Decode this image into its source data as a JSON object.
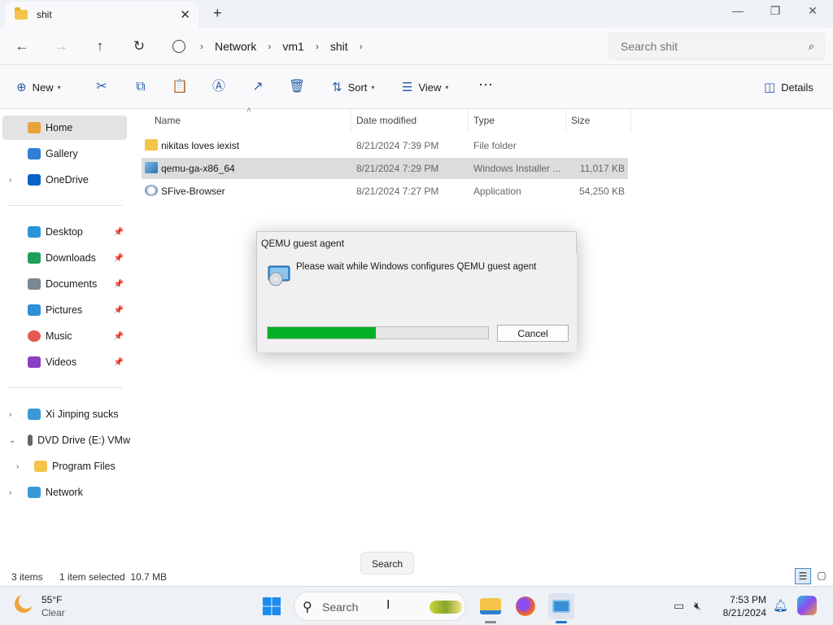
{
  "window": {
    "tab_title": "shit",
    "tab_close": "✕",
    "tab_add": "+",
    "minimize": "—",
    "maximize": "❐",
    "close": "✕"
  },
  "address": {
    "back": "←",
    "forward": "→",
    "up": "↑",
    "refresh": "↻",
    "breadcrumbs": [
      "Network",
      "vm1",
      "shit"
    ],
    "separator": "›",
    "search_placeholder": "Search shit",
    "search_icon": "⌕"
  },
  "toolbar": {
    "new_label": "New",
    "sort_label": "Sort",
    "view_label": "View",
    "more_label": "···",
    "details_label": "Details",
    "icons": {
      "new": "⊕",
      "cut": "✂",
      "copy": "⧉",
      "paste": "📋",
      "rename": "Ⓐ",
      "share": "↗",
      "delete": "🗑",
      "sort": "⇅",
      "view": "☰",
      "details": "◫"
    }
  },
  "sidebar": {
    "items": [
      {
        "label": "Home",
        "color": "#e8a23a"
      },
      {
        "label": "Gallery",
        "color": "#2f7fd6"
      },
      {
        "label": "OneDrive",
        "color": "#0a64c8"
      },
      {
        "label": "Desktop",
        "color": "#2b94d8"
      },
      {
        "label": "Downloads",
        "color": "#1f9e5a"
      },
      {
        "label": "Documents",
        "color": "#7a8794"
      },
      {
        "label": "Pictures",
        "color": "#2f8fd8"
      },
      {
        "label": "Music",
        "color": "#e5584f"
      },
      {
        "label": "Videos",
        "color": "#8b3fc4"
      },
      {
        "label": "Xi Jinping sucks",
        "color": "#3a9ad9"
      },
      {
        "label": "DVD Drive (E:) VMw",
        "color": "#666666"
      },
      {
        "label": "Program Files",
        "color": "#f5c44a"
      },
      {
        "label": "Network",
        "color": "#3a9ad9"
      }
    ],
    "pin": "📌",
    "chev_right": "›",
    "chev_down": "⌄"
  },
  "columns": {
    "name": "Name",
    "date": "Date modified",
    "type": "Type",
    "size": "Size",
    "sort_arrow": "˄"
  },
  "files": [
    {
      "name": "nikitas loves iexist",
      "date": "8/21/2024 7:39 PM",
      "type": "File folder",
      "size": ""
    },
    {
      "name": "qemu-ga-x86_64",
      "date": "8/21/2024 7:29 PM",
      "type": "Windows Installer ...",
      "size": "11,017 KB"
    },
    {
      "name": "SFive-Browser",
      "date": "8/21/2024 7:27 PM",
      "type": "Application",
      "size": "54,250 KB"
    }
  ],
  "dialog": {
    "title": "QEMU guest agent",
    "message": "Please wait while Windows configures QEMU guest agent",
    "progress": 0.49,
    "cancel_label": "Cancel"
  },
  "status": {
    "items_count": "3 items",
    "selection": "1 item selected  10.7 MB",
    "tooltip": "Search"
  },
  "taskbar": {
    "weather_temp": "55°F",
    "weather_desc": "Clear",
    "search_label": "Search",
    "time": "7:53 PM",
    "date": "8/21/2024"
  }
}
